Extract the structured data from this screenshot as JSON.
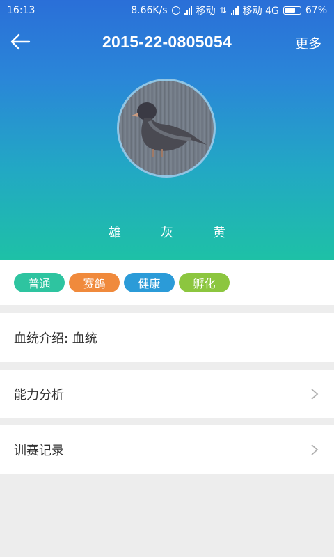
{
  "status_bar": {
    "time": "16:13",
    "speed": "8.66K/s",
    "carrier1": "移动",
    "carrier2": "移动 4G",
    "battery": "67%"
  },
  "header": {
    "title": "2015-22-0805054",
    "more_label": "更多"
  },
  "attributes": [
    "雄",
    "灰",
    "黄"
  ],
  "tags": [
    {
      "label": "普通",
      "color": "#2ec4a0"
    },
    {
      "label": "赛鸽",
      "color": "#f08a3c"
    },
    {
      "label": "健康",
      "color": "#2b9bd8"
    },
    {
      "label": "孵化",
      "color": "#8cc63f"
    }
  ],
  "rows": {
    "pedigree": "血统介绍: 血统",
    "ability": "能力分析",
    "training": "训赛记录"
  },
  "colors": {
    "gradient_top": "#2a6fd8",
    "gradient_bottom": "#1ec1a6",
    "background": "#ededed"
  }
}
